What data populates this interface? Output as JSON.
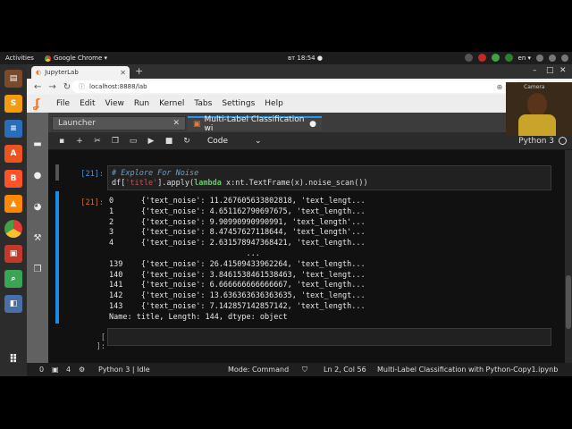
{
  "os": {
    "activities": "Activities",
    "app_menu": "Google Chrome ▾",
    "clock": "вт 18:54 ●",
    "lang": "en ▾"
  },
  "browser": {
    "tab_title": "JupyterLab",
    "url": "localhost:8888/lab"
  },
  "jupyter": {
    "menu": [
      "File",
      "Edit",
      "View",
      "Run",
      "Kernel",
      "Tabs",
      "Settings",
      "Help"
    ],
    "tabs": [
      {
        "label": "Launcher",
        "close": "✕"
      },
      {
        "label": "Multi-Label Classification wi",
        "close": "●"
      }
    ],
    "toolbar": {
      "cell_type": "Code",
      "kernel_name": "Python 3"
    },
    "cell_in": {
      "prompt": "[21]:",
      "comment": "# Explore For Noise",
      "code_pre": "df[",
      "code_str": "'title'",
      "code_mid": "].apply(",
      "code_kw": "lambda",
      "code_post": " x:nt.TextFrame(x).noise_scan())"
    },
    "cell_out": {
      "prompt": "[21]:",
      "lines": [
        "0      {'text_noise': 11.267605633802818, 'text_lengt...",
        "1      {'text_noise': 4.651162790697675, 'text_length...",
        "2      {'text_noise': 9.90990990990991, 'text_length'...",
        "3      {'text_noise': 8.47457627118644, 'text_length'...",
        "4      {'text_noise': 2.631578947368421, 'text_length...",
        "                              ...",
        "139    {'text_noise': 26.41509433962264, 'text_length...",
        "140    {'text_noise': 3.8461538461538463, 'text_lengt...",
        "141    {'text_noise': 6.666666666666667, 'text_length...",
        "142    {'text_noise': 13.636363636363635, 'text_lengt...",
        "143    {'text_noise': 7.142857142857142, 'text_length...",
        "Name: title, Length: 144, dtype: object"
      ]
    },
    "cell_empty": {
      "prompt": "[ ]:"
    },
    "status": {
      "left_a": "0",
      "left_b": "4",
      "kernel": "Python 3 | Idle",
      "mode": "Mode: Command",
      "position": "Ln 2, Col 56",
      "filename": "Multi-Label Classification with Python-Copy1.ipynb"
    }
  },
  "webcam": {
    "label": "Camera"
  }
}
